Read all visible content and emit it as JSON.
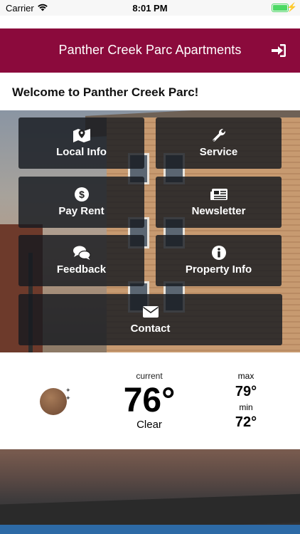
{
  "status_bar": {
    "carrier": "Carrier",
    "time": "8:01 PM"
  },
  "nav": {
    "title": "Panther Creek Parc Apartments",
    "logout_icon": "sign-in-icon"
  },
  "welcome": {
    "text": "Welcome to Panther Creek Parc!"
  },
  "tiles": [
    {
      "label": "Local Info",
      "icon": "map-marker-icon"
    },
    {
      "label": "Service",
      "icon": "wrench-icon"
    },
    {
      "label": "Pay Rent",
      "icon": "dollar-icon"
    },
    {
      "label": "Newsletter",
      "icon": "newspaper-icon"
    },
    {
      "label": "Feedback",
      "icon": "comments-icon"
    },
    {
      "label": "Property Info",
      "icon": "info-icon"
    },
    {
      "label": "Contact",
      "icon": "envelope-icon"
    }
  ],
  "weather": {
    "current_label": "current",
    "temp": "76°",
    "condition": "Clear",
    "max_label": "max",
    "max": "79°",
    "min_label": "min",
    "min": "72°",
    "icon": "moon-icon"
  },
  "colors": {
    "nav_bg": "#8b0a3c",
    "battery": "#4cd964"
  }
}
